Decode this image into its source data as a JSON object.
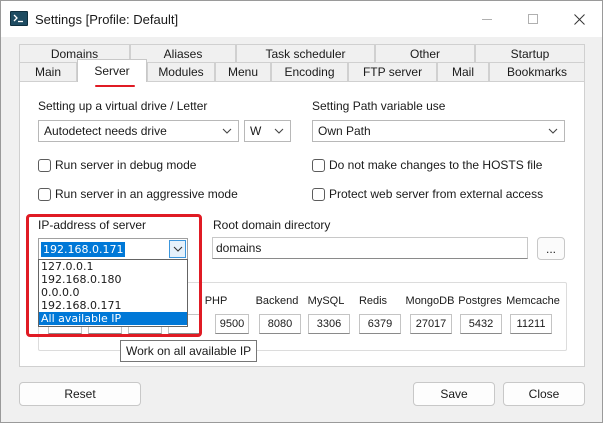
{
  "window": {
    "title": "Settings [Profile: Default]"
  },
  "tabs": {
    "back_row": [
      "Domains",
      "Aliases",
      "Task scheduler",
      "Other",
      "Startup"
    ],
    "front_row": [
      "Main",
      "Server",
      "Modules",
      "Menu",
      "Encoding",
      "FTP server",
      "Mail",
      "Bookmarks"
    ],
    "active": "Server"
  },
  "server": {
    "virtual_drive_label": "Setting up a virtual drive / Letter",
    "virtual_drive_value": "Autodetect needs drive",
    "drive_letter_value": "W",
    "path_var_label": "Setting Path variable use",
    "path_var_value": "Own Path",
    "checkboxes": [
      {
        "label": "Run server in debug mode",
        "checked": false
      },
      {
        "label": "Do not make changes to the HOSTS file",
        "checked": false
      },
      {
        "label": "Run server in an aggressive mode",
        "checked": false
      },
      {
        "label": "Protect web server from external access",
        "checked": false
      }
    ],
    "ip_label": "IP-address of server",
    "ip_value": "192.168.0.171",
    "ip_options": [
      "127.0.0.1",
      "192.168.0.180",
      "0.0.0.0",
      "192.168.0.171",
      "All available IP"
    ],
    "ip_highlighted": "All available IP",
    "root_domain_label": "Root domain directory",
    "root_domain_value": "domains",
    "browse_label": "...",
    "ports": [
      {
        "name": "PHP",
        "value": "9500"
      },
      {
        "name": "Backend",
        "value": "8080"
      },
      {
        "name": "MySQL",
        "value": "3306"
      },
      {
        "name": "Redis",
        "value": "6379"
      },
      {
        "name": "MongoDB",
        "value": "27017"
      },
      {
        "name": "Postgres",
        "value": "5432"
      },
      {
        "name": "Memcache",
        "value": "11211"
      }
    ],
    "tooltip": "Work on all available IP"
  },
  "footer": {
    "reset_label": "Reset",
    "save_label": "Save",
    "close_label": "Close"
  },
  "colors": {
    "accent": "#0078d7",
    "annotation_red": "#e01b24"
  }
}
